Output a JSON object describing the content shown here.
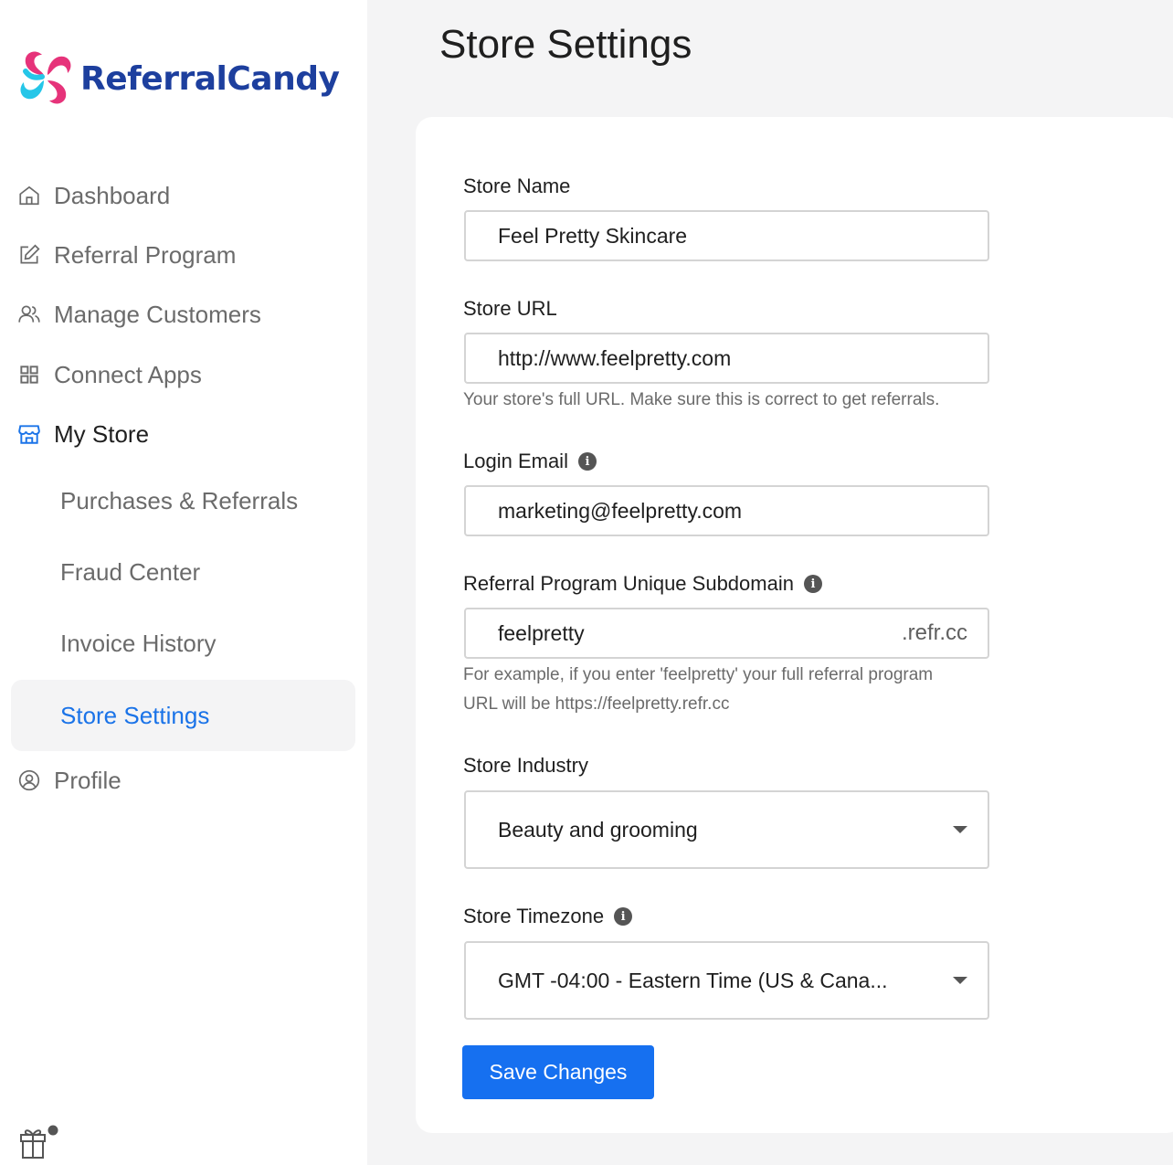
{
  "app": {
    "brand": "ReferralCandy",
    "page_title": "Store Settings"
  },
  "colors": {
    "accent": "#1670f0",
    "brand_blue": "#1d3f9e",
    "logo_pink": "#e6337a",
    "logo_cyan": "#25c6e8"
  },
  "sidebar": {
    "items": [
      {
        "label": "Dashboard",
        "icon": "home-icon"
      },
      {
        "label": "Referral Program",
        "icon": "edit-icon"
      },
      {
        "label": "Manage Customers",
        "icon": "users-icon"
      },
      {
        "label": "Connect Apps",
        "icon": "grid-icon"
      },
      {
        "label": "My Store",
        "icon": "store-icon"
      },
      {
        "label": "Profile",
        "icon": "user-circle-icon"
      }
    ],
    "sub_items": [
      {
        "label": "Purchases & Referrals"
      },
      {
        "label": "Fraud Center"
      },
      {
        "label": "Invoice History"
      },
      {
        "label": "Store Settings"
      }
    ],
    "footer_icon": "gift-icon"
  },
  "form": {
    "store_name": {
      "label": "Store Name",
      "value": "Feel Pretty Skincare"
    },
    "store_url": {
      "label": "Store URL",
      "value": "http://www.feelpretty.com",
      "help": "Your store's full URL. Make sure this is correct to get referrals."
    },
    "login_email": {
      "label": "Login Email",
      "value": "marketing@feelpretty.com"
    },
    "subdomain": {
      "label": "Referral Program Unique Subdomain",
      "value": "feelpretty",
      "suffix": ".refr.cc",
      "help_line1": "For example, if you enter 'feelpretty' your full referral program",
      "help_line2": "URL will be https://feelpretty.refr.cc"
    },
    "industry": {
      "label": "Store Industry",
      "value": "Beauty and grooming"
    },
    "timezone": {
      "label": "Store Timezone",
      "value": "GMT -04:00 - Eastern Time (US & Cana..."
    },
    "save_label": "Save Changes",
    "info_glyph": "i"
  }
}
